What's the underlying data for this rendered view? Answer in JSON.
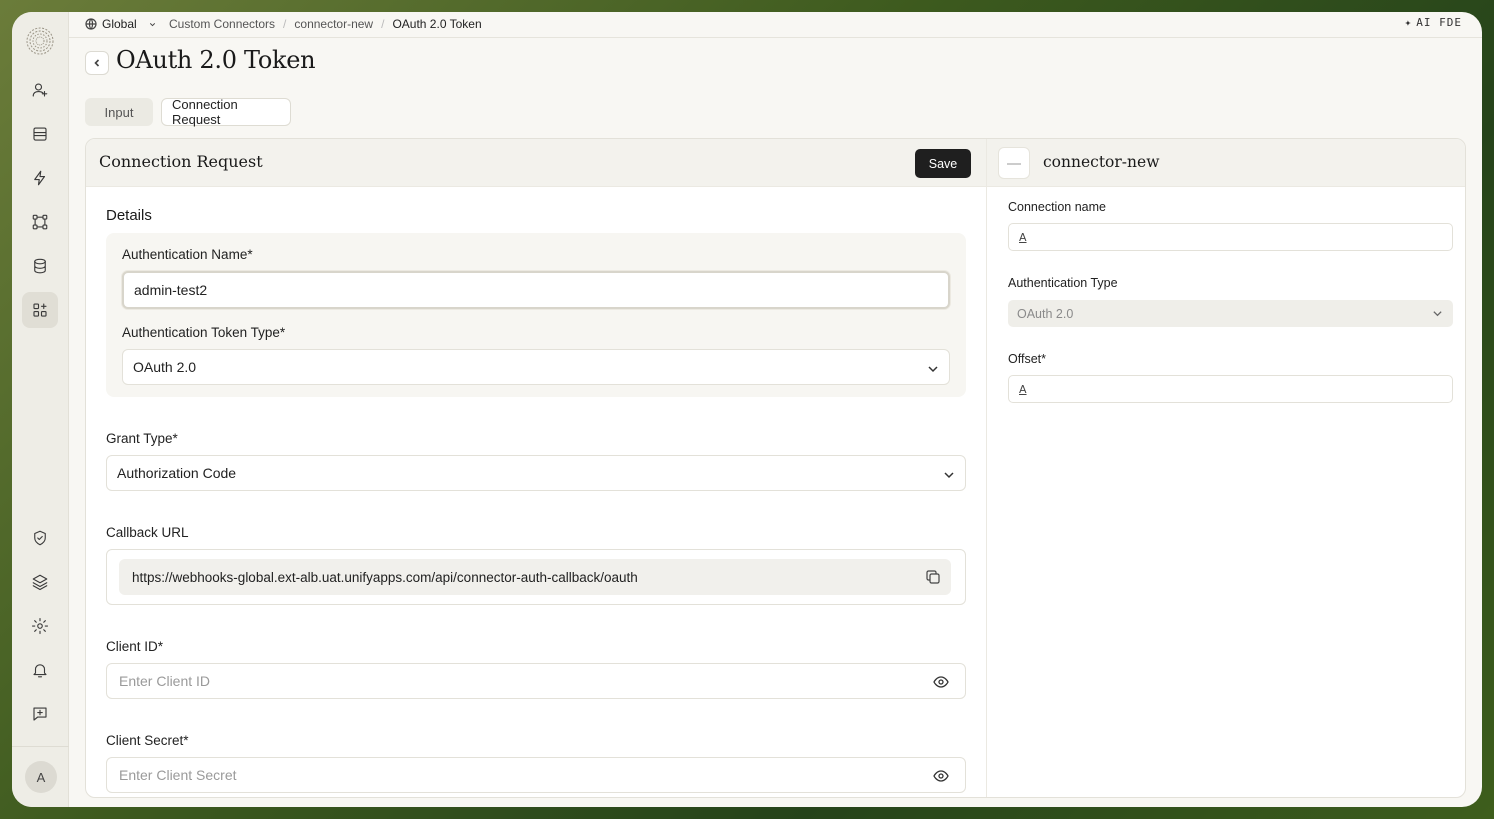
{
  "topbar": {
    "scope_label": "Global",
    "breadcrumbs": [
      "Custom Connectors",
      "connector-new",
      "OAuth 2.0 Token"
    ],
    "ai_label": "AI FDE"
  },
  "page": {
    "title": "OAuth 2.0 Token"
  },
  "tabs": [
    {
      "label": "Input",
      "active": false
    },
    {
      "label": "Connection Request",
      "active": true
    }
  ],
  "left_panel": {
    "title": "Connection Request",
    "save_label": "Save",
    "section_title": "Details",
    "fields": {
      "auth_name_label": "Authentication Name*",
      "auth_name_value": "admin-test2",
      "token_type_label": "Authentication Token Type*",
      "token_type_value": "OAuth 2.0",
      "grant_type_label": "Grant Type*",
      "grant_type_value": "Authorization Code",
      "callback_label": "Callback URL",
      "callback_value": "https://webhooks-global.ext-alb.uat.unifyapps.com/api/connector-auth-callback/oauth",
      "client_id_label": "Client ID*",
      "client_id_placeholder": "Enter Client ID",
      "client_secret_label": "Client Secret*",
      "client_secret_placeholder": "Enter Client Secret"
    }
  },
  "right_panel": {
    "connector_name": "connector-new",
    "connection_name_label": "Connection name",
    "connection_name_type_icon": "A",
    "auth_type_label": "Authentication Type",
    "auth_type_value": "OAuth 2.0",
    "offset_label": "Offset*",
    "offset_type_icon": "A"
  },
  "user": {
    "avatar_initial": "A"
  },
  "colors": {
    "save_button": "#1f1f1f",
    "background": "#f8f7f3",
    "sidebar": "#eeede6"
  }
}
